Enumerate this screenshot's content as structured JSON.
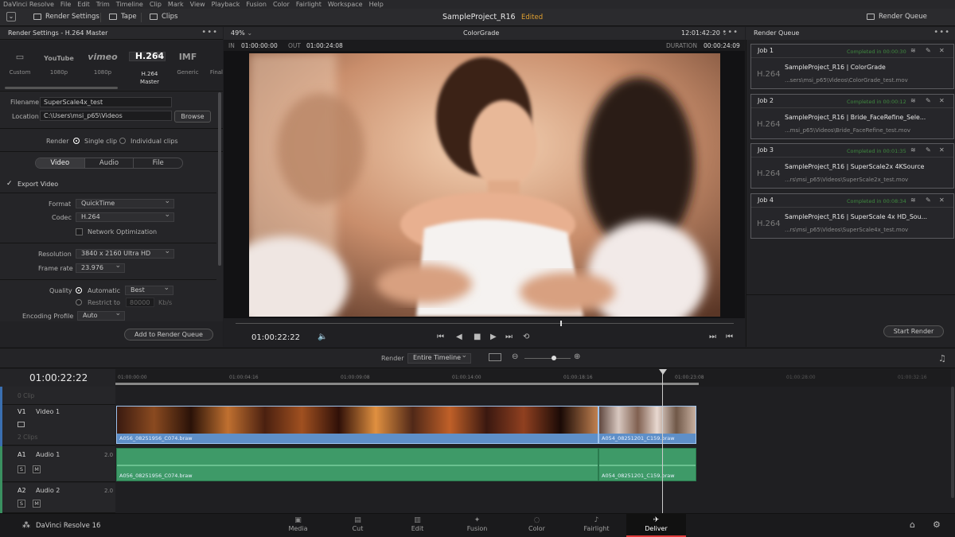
{
  "menu": [
    "DaVinci Resolve",
    "File",
    "Edit",
    "Trim",
    "Timeline",
    "Clip",
    "Mark",
    "View",
    "Playback",
    "Fusion",
    "Color",
    "Fairlight",
    "Workspace",
    "Help"
  ],
  "toolbar": {
    "render_settings": "Render Settings",
    "tape": "Tape",
    "clips": "Clips",
    "render_queue": "Render Queue"
  },
  "project": {
    "name": "SampleProject_R16",
    "status": "Edited"
  },
  "render_settings": {
    "header": "Render Settings - H.264 Master",
    "presets": [
      {
        "logo": "▭",
        "label": "Custom"
      },
      {
        "logo": "YouTube",
        "label": "1080p"
      },
      {
        "logo": "vimeo",
        "label": "1080p"
      },
      {
        "logo": "H.264",
        "label": "H.264 Master"
      },
      {
        "logo": "IMF",
        "label": "Generic"
      },
      {
        "logo": "",
        "label": "Final"
      }
    ],
    "filename_label": "Filename",
    "filename": "SuperScale4x_test",
    "location_label": "Location",
    "location": "C:\\Users\\msi_p65\\Videos",
    "browse": "Browse",
    "render_label": "Render",
    "single_clip": "Single clip",
    "individual_clips": "Individual clips",
    "tabs": [
      "Video",
      "Audio",
      "File"
    ],
    "export_video": "Export Video",
    "format_label": "Format",
    "format": "QuickTime",
    "codec_label": "Codec",
    "codec": "H.264",
    "network_opt": "Network Optimization",
    "resolution_label": "Resolution",
    "resolution": "3840 x 2160 Ultra HD",
    "framerate_label": "Frame rate",
    "framerate": "23.976",
    "quality_label": "Quality",
    "automatic": "Automatic",
    "best": "Best",
    "restrict_to": "Restrict to",
    "restrict_value": "80000",
    "kbs": "Kb/s",
    "encoding_label": "Encoding Profile",
    "encoding": "Auto",
    "add_to_queue": "Add to Render Queue"
  },
  "viewer": {
    "zoom": "49%",
    "mode": "ColorGrade",
    "timecode": "12:01:42:20",
    "in_label": "IN",
    "in": "01:00:00:00",
    "out_label": "OUT",
    "out": "01:00:24:08",
    "duration_label": "DURATION",
    "duration": "00:00:24:09",
    "current": "01:00:22:22"
  },
  "render_queue": {
    "header": "Render Queue",
    "jobs": [
      {
        "title": "Job 1",
        "status": "Completed in 00:00:30",
        "codec": "H.264",
        "name": "SampleProject_R16 | ColorGrade",
        "path": "...sers\\msi_p65\\Videos\\ColorGrade_test.mov"
      },
      {
        "title": "Job 2",
        "status": "Completed in 00:00:12",
        "codec": "H.264",
        "name": "SampleProject_R16 | Bride_FaceRefine_Sele...",
        "path": "...msi_p65\\Videos\\Bride_FaceRefine_test.mov"
      },
      {
        "title": "Job 3",
        "status": "Completed in 00:01:35",
        "codec": "H.264",
        "name": "SampleProject_R16 | SuperScale2x 4KSource",
        "path": "...rs\\msi_p65\\Videos\\SuperScale2x_test.mov"
      },
      {
        "title": "Job 4",
        "status": "Completed in 00:08:34",
        "codec": "H.264",
        "name": "SampleProject_R16 | SuperScale 4x HD_Sou...",
        "path": "...rs\\msi_p65\\Videos\\SuperScale4x_test.mov"
      }
    ],
    "start_render": "Start Render"
  },
  "timeline": {
    "render_label": "Render",
    "render_range": "Entire Timeline",
    "timecode": "01:00:22:22",
    "ruler": [
      "01:00:00:00",
      "01:00:04:16",
      "01:00:09:08",
      "01:00:14:00",
      "01:00:18:16",
      "01:00:23:08",
      "01:00:28:00",
      "01:00:32:16"
    ],
    "tracks": {
      "v_empty": "0 Clip",
      "v1_id": "V1",
      "v1_name": "Video 1",
      "v1_clips": "2 Clips",
      "a1_id": "A1",
      "a1_name": "Audio 1",
      "a1_ch": "2.0",
      "a2_id": "A2",
      "a2_name": "Audio 2",
      "a2_ch": "2.0",
      "s": "S",
      "m": "M"
    },
    "clip1": "A056_08251956_C074.braw",
    "clip2": "A054_08251201_C159.braw"
  },
  "pages": [
    "Media",
    "Cut",
    "Edit",
    "Fusion",
    "Color",
    "Fairlight",
    "Deliver"
  ],
  "app_name": "DaVinci Resolve 16"
}
